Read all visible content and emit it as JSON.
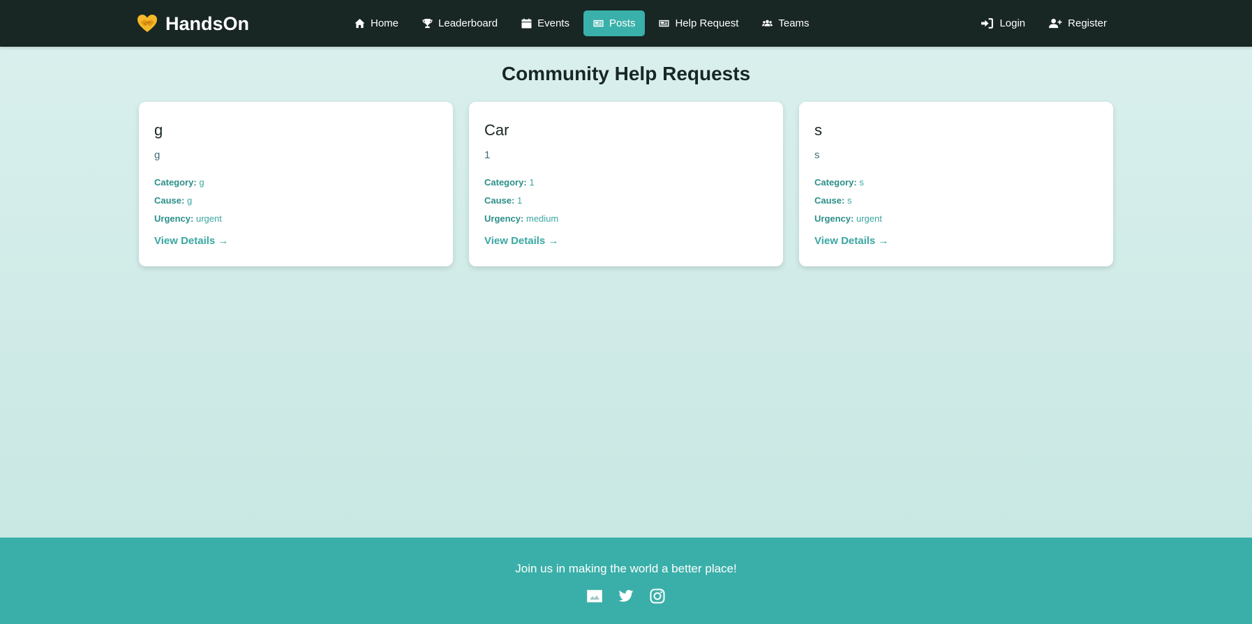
{
  "brand": {
    "name": "HandsOn",
    "logo_icon": "handshake-heart-icon"
  },
  "nav": {
    "center": [
      {
        "label": "Home",
        "icon": "home-icon"
      },
      {
        "label": "Leaderboard",
        "icon": "trophy-icon"
      },
      {
        "label": "Events",
        "icon": "calendar-icon"
      },
      {
        "label": "Posts",
        "icon": "newspaper-icon",
        "active": true
      },
      {
        "label": "Help Request",
        "icon": "newspaper-icon"
      },
      {
        "label": "Teams",
        "icon": "users-icon"
      }
    ],
    "right": [
      {
        "label": "Login",
        "icon": "sign-in-icon"
      },
      {
        "label": "Register",
        "icon": "user-plus-icon"
      }
    ]
  },
  "main": {
    "title": "Community Help Requests",
    "labels": {
      "category": "Category:",
      "cause": "Cause:",
      "urgency": "Urgency:"
    },
    "view_details": "View Details →",
    "cards": [
      {
        "title": "g",
        "description": "g",
        "category": "g",
        "cause": "g",
        "urgency": "urgent"
      },
      {
        "title": "Car",
        "description": "1",
        "category": "1",
        "cause": "1",
        "urgency": "medium"
      },
      {
        "title": "s",
        "description": "s",
        "category": "s",
        "cause": "s",
        "urgency": "urgent"
      }
    ]
  },
  "footer": {
    "text": "Join us in making the world a better place!",
    "socials": [
      "facebook-image-icon",
      "twitter-icon",
      "instagram-icon"
    ]
  },
  "colors": {
    "navbar": "#182624",
    "accent": "#3ab0aa",
    "footer": "#3aafa9",
    "page_bg_top": "#daf0ee",
    "page_bg_bottom": "#c6e6e1",
    "meta_text": "#3aa7a2",
    "logo_yellow": "#f5b829"
  }
}
